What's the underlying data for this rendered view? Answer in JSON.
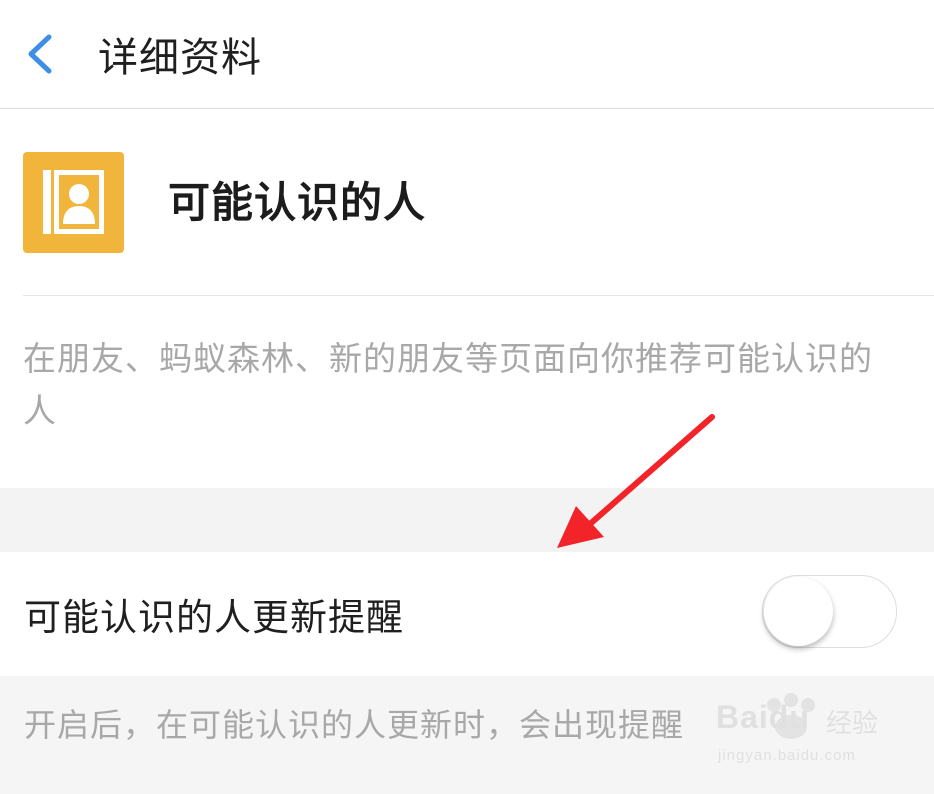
{
  "header": {
    "back_icon": "chevron-left-icon",
    "title": "详细资料",
    "accent_color": "#3e8ee8"
  },
  "app": {
    "icon": "contact-book-icon",
    "icon_color": "#f2b53c",
    "name": "可能认识的人",
    "description": "在朋友、蚂蚁森林、新的朋友等页面向你推荐可能认识的人"
  },
  "setting": {
    "label": "可能认识的人更新提醒",
    "enabled": false,
    "note": "开启后，在可能认识的人更新时，会出现提醒"
  },
  "annotation": {
    "arrow_color": "#f2242a"
  },
  "watermark": {
    "brand": "Baidu",
    "jingyan": "经验",
    "url": "jingyan.baidu.com"
  }
}
